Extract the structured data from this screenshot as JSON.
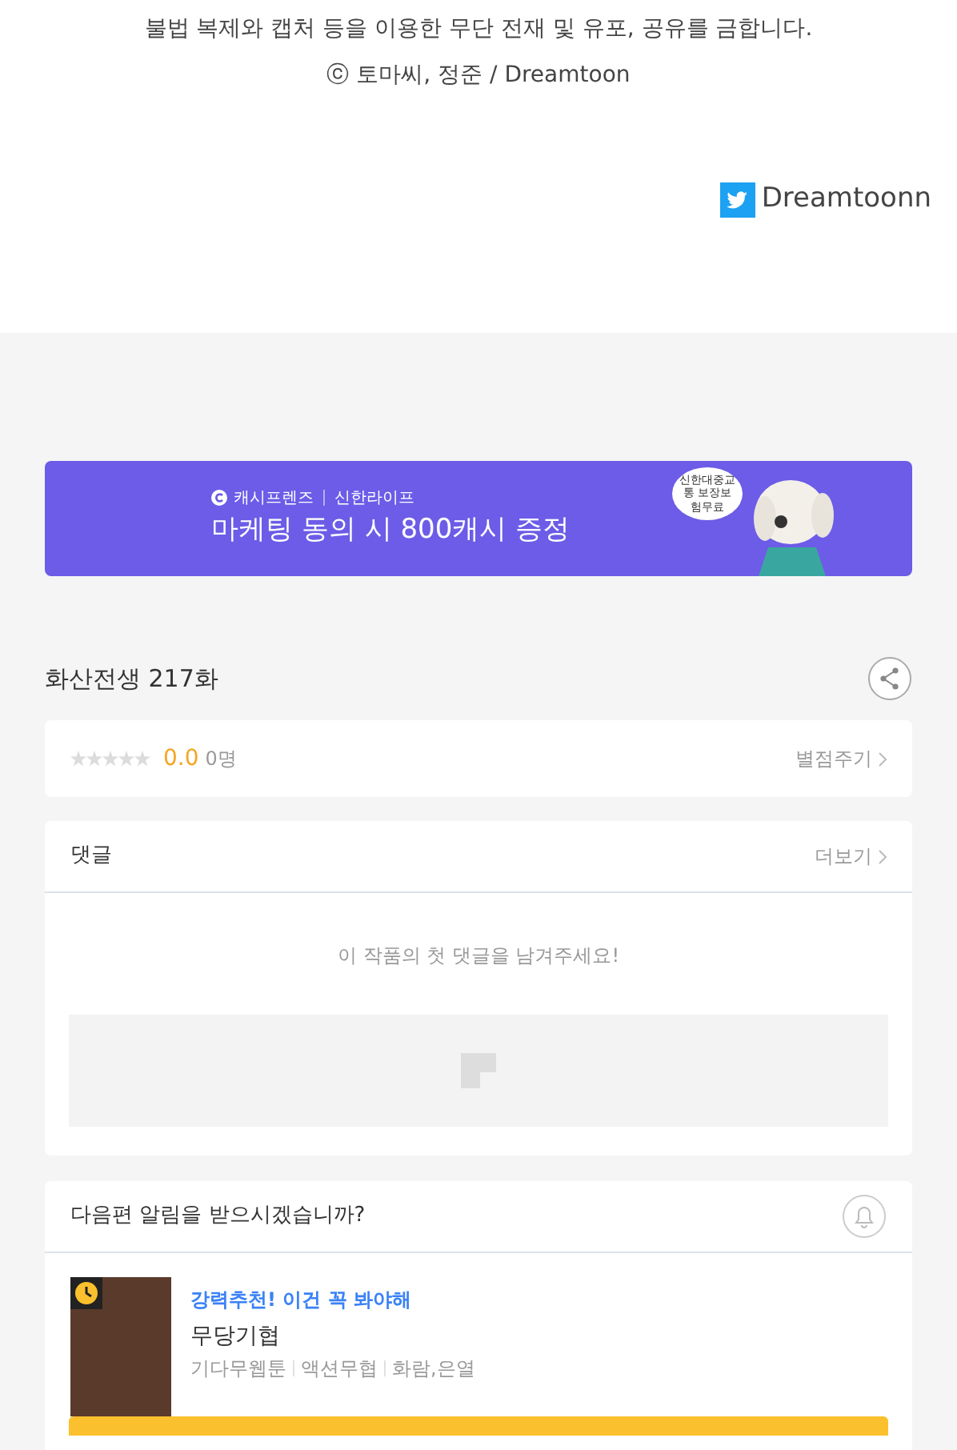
{
  "notice": {
    "line": "불법 복제와 캡처 등을 이용한 무단 전재 및 유포, 공유를 금합니다.",
    "copyright": "ⓒ 토마씨, 정준 / Dreamtoon",
    "twitter": "Dreamtoonn"
  },
  "banner": {
    "brand": "캐시프렌즈",
    "partner": "신한라이프",
    "headline": "마케팅 동의 시 800캐시 증정",
    "bubble": "신한대중교통 보장보험무료"
  },
  "episode": {
    "title": "화산전생 217화"
  },
  "rating": {
    "stars": 0,
    "score": "0.0",
    "count": "0명",
    "action": "별점주기"
  },
  "comments": {
    "title": "댓글",
    "more": "더보기",
    "empty": "이 작품의 첫 댓글을 남겨주세요!"
  },
  "alert": {
    "question": "다음편 알림을 받으시겠습니까?"
  },
  "recommend": {
    "tag": "강력추천! 이건 꼭 봐야해",
    "title": "무당기협",
    "meta": [
      "기다무웹툰",
      "액션무협",
      "화람,은열"
    ]
  }
}
